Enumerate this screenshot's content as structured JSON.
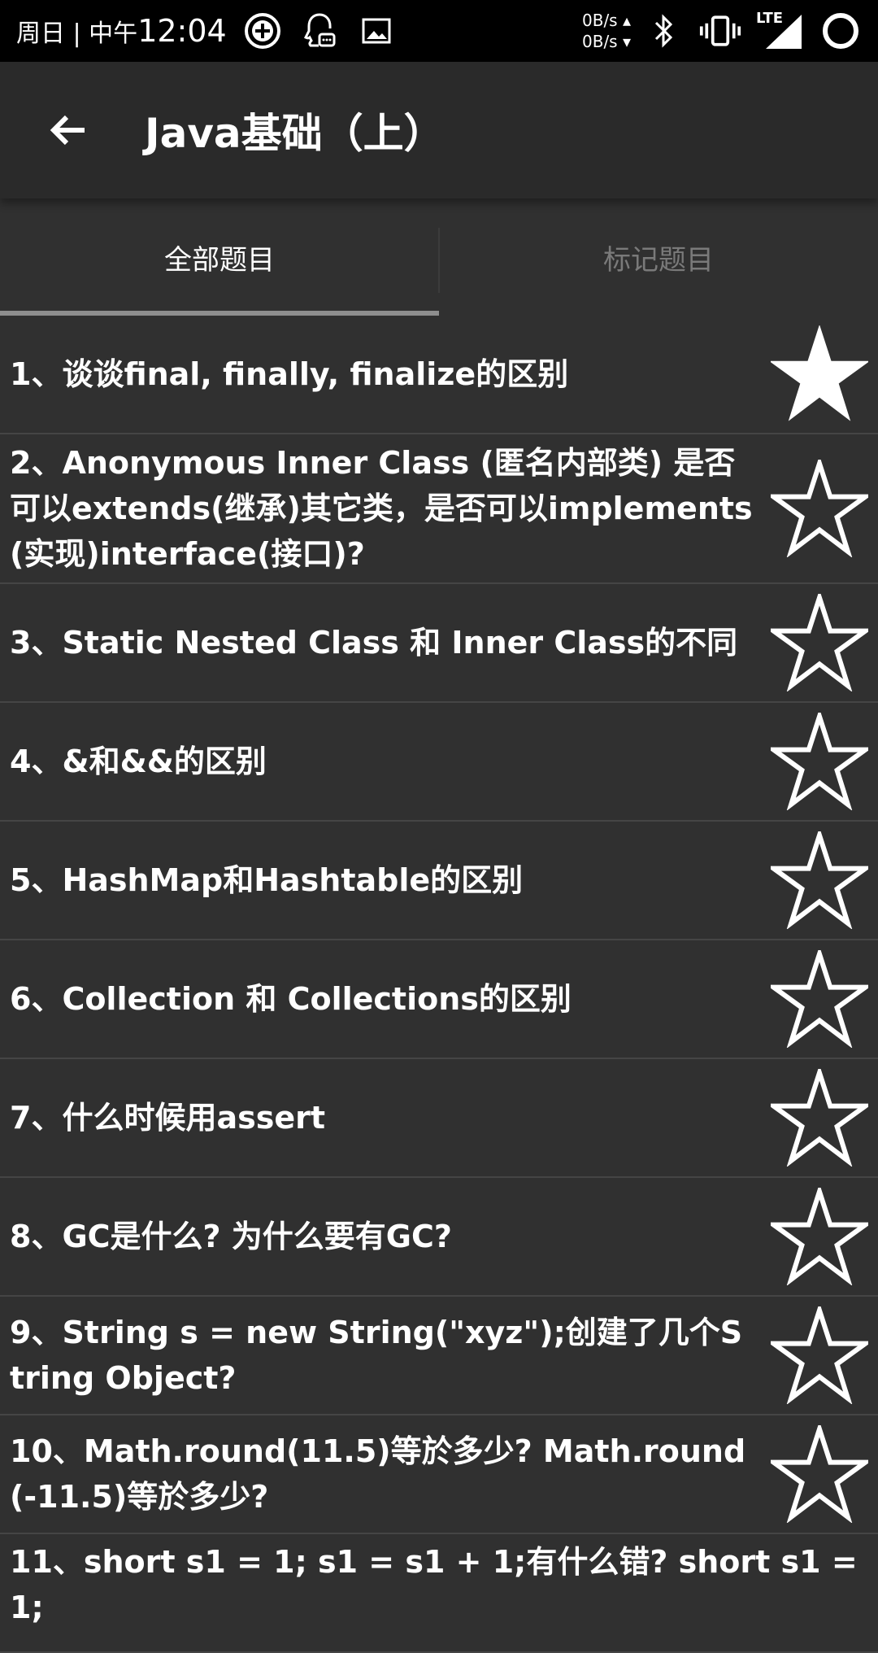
{
  "status_bar": {
    "time_prefix": "周日 | 中午",
    "time": "12:04",
    "speed_up": "0B/s ▴",
    "speed_down": "0B/s ▾",
    "network": "LTE"
  },
  "app_bar": {
    "title": "Java基础（上）"
  },
  "tabs": [
    {
      "label": "全部题目",
      "active": true
    },
    {
      "label": "标记题目",
      "active": false
    }
  ],
  "questions": [
    {
      "text": "1、谈谈final, finally, finalize的区别",
      "starred": true
    },
    {
      "text": "2、Anonymous Inner Class (匿名内部类) 是否可以extends(继承)其它类，是否可以implements(实现)interface(接口)?",
      "starred": false
    },
    {
      "text": "3、Static Nested Class 和 Inner Class的不同",
      "starred": false
    },
    {
      "text": "4、&和&&的区别",
      "starred": false
    },
    {
      "text": "5、HashMap和Hashtable的区别",
      "starred": false
    },
    {
      "text": "6、Collection 和 Collections的区别",
      "starred": false
    },
    {
      "text": "7、什么时候用assert",
      "starred": false
    },
    {
      "text": "8、GC是什么? 为什么要有GC?",
      "starred": false
    },
    {
      "text": "9、String s = new String(\"xyz\");创建了几个String Object?",
      "starred": false
    },
    {
      "text": "10、Math.round(11.5)等於多少? Math.round(-11.5)等於多少?",
      "starred": false
    },
    {
      "text": "11、short s1 = 1; s1 = s1 + 1;有什么错? short s1 = 1;",
      "starred": false
    }
  ]
}
